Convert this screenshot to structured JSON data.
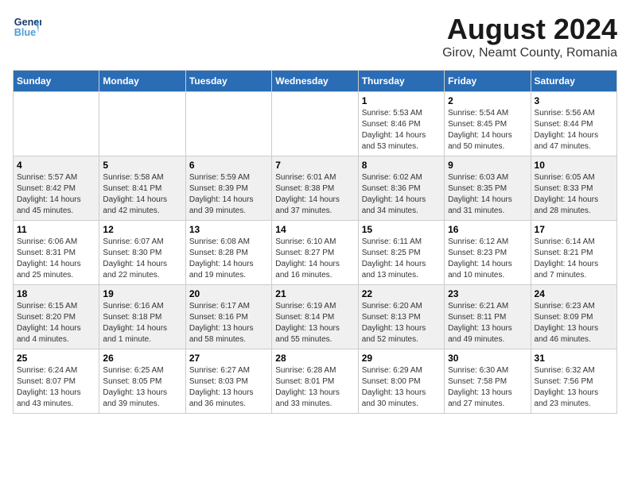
{
  "header": {
    "logo_line1": "General",
    "logo_line2": "Blue",
    "title": "August 2024",
    "subtitle": "Girov, Neamt County, Romania"
  },
  "weekdays": [
    "Sunday",
    "Monday",
    "Tuesday",
    "Wednesday",
    "Thursday",
    "Friday",
    "Saturday"
  ],
  "weeks": [
    [
      {
        "day": "",
        "info": ""
      },
      {
        "day": "",
        "info": ""
      },
      {
        "day": "",
        "info": ""
      },
      {
        "day": "",
        "info": ""
      },
      {
        "day": "1",
        "info": "Sunrise: 5:53 AM\nSunset: 8:46 PM\nDaylight: 14 hours\nand 53 minutes."
      },
      {
        "day": "2",
        "info": "Sunrise: 5:54 AM\nSunset: 8:45 PM\nDaylight: 14 hours\nand 50 minutes."
      },
      {
        "day": "3",
        "info": "Sunrise: 5:56 AM\nSunset: 8:44 PM\nDaylight: 14 hours\nand 47 minutes."
      }
    ],
    [
      {
        "day": "4",
        "info": "Sunrise: 5:57 AM\nSunset: 8:42 PM\nDaylight: 14 hours\nand 45 minutes."
      },
      {
        "day": "5",
        "info": "Sunrise: 5:58 AM\nSunset: 8:41 PM\nDaylight: 14 hours\nand 42 minutes."
      },
      {
        "day": "6",
        "info": "Sunrise: 5:59 AM\nSunset: 8:39 PM\nDaylight: 14 hours\nand 39 minutes."
      },
      {
        "day": "7",
        "info": "Sunrise: 6:01 AM\nSunset: 8:38 PM\nDaylight: 14 hours\nand 37 minutes."
      },
      {
        "day": "8",
        "info": "Sunrise: 6:02 AM\nSunset: 8:36 PM\nDaylight: 14 hours\nand 34 minutes."
      },
      {
        "day": "9",
        "info": "Sunrise: 6:03 AM\nSunset: 8:35 PM\nDaylight: 14 hours\nand 31 minutes."
      },
      {
        "day": "10",
        "info": "Sunrise: 6:05 AM\nSunset: 8:33 PM\nDaylight: 14 hours\nand 28 minutes."
      }
    ],
    [
      {
        "day": "11",
        "info": "Sunrise: 6:06 AM\nSunset: 8:31 PM\nDaylight: 14 hours\nand 25 minutes."
      },
      {
        "day": "12",
        "info": "Sunrise: 6:07 AM\nSunset: 8:30 PM\nDaylight: 14 hours\nand 22 minutes."
      },
      {
        "day": "13",
        "info": "Sunrise: 6:08 AM\nSunset: 8:28 PM\nDaylight: 14 hours\nand 19 minutes."
      },
      {
        "day": "14",
        "info": "Sunrise: 6:10 AM\nSunset: 8:27 PM\nDaylight: 14 hours\nand 16 minutes."
      },
      {
        "day": "15",
        "info": "Sunrise: 6:11 AM\nSunset: 8:25 PM\nDaylight: 14 hours\nand 13 minutes."
      },
      {
        "day": "16",
        "info": "Sunrise: 6:12 AM\nSunset: 8:23 PM\nDaylight: 14 hours\nand 10 minutes."
      },
      {
        "day": "17",
        "info": "Sunrise: 6:14 AM\nSunset: 8:21 PM\nDaylight: 14 hours\nand 7 minutes."
      }
    ],
    [
      {
        "day": "18",
        "info": "Sunrise: 6:15 AM\nSunset: 8:20 PM\nDaylight: 14 hours\nand 4 minutes."
      },
      {
        "day": "19",
        "info": "Sunrise: 6:16 AM\nSunset: 8:18 PM\nDaylight: 14 hours\nand 1 minute."
      },
      {
        "day": "20",
        "info": "Sunrise: 6:17 AM\nSunset: 8:16 PM\nDaylight: 13 hours\nand 58 minutes."
      },
      {
        "day": "21",
        "info": "Sunrise: 6:19 AM\nSunset: 8:14 PM\nDaylight: 13 hours\nand 55 minutes."
      },
      {
        "day": "22",
        "info": "Sunrise: 6:20 AM\nSunset: 8:13 PM\nDaylight: 13 hours\nand 52 minutes."
      },
      {
        "day": "23",
        "info": "Sunrise: 6:21 AM\nSunset: 8:11 PM\nDaylight: 13 hours\nand 49 minutes."
      },
      {
        "day": "24",
        "info": "Sunrise: 6:23 AM\nSunset: 8:09 PM\nDaylight: 13 hours\nand 46 minutes."
      }
    ],
    [
      {
        "day": "25",
        "info": "Sunrise: 6:24 AM\nSunset: 8:07 PM\nDaylight: 13 hours\nand 43 minutes."
      },
      {
        "day": "26",
        "info": "Sunrise: 6:25 AM\nSunset: 8:05 PM\nDaylight: 13 hours\nand 39 minutes."
      },
      {
        "day": "27",
        "info": "Sunrise: 6:27 AM\nSunset: 8:03 PM\nDaylight: 13 hours\nand 36 minutes."
      },
      {
        "day": "28",
        "info": "Sunrise: 6:28 AM\nSunset: 8:01 PM\nDaylight: 13 hours\nand 33 minutes."
      },
      {
        "day": "29",
        "info": "Sunrise: 6:29 AM\nSunset: 8:00 PM\nDaylight: 13 hours\nand 30 minutes."
      },
      {
        "day": "30",
        "info": "Sunrise: 6:30 AM\nSunset: 7:58 PM\nDaylight: 13 hours\nand 27 minutes."
      },
      {
        "day": "31",
        "info": "Sunrise: 6:32 AM\nSunset: 7:56 PM\nDaylight: 13 hours\nand 23 minutes."
      }
    ]
  ]
}
